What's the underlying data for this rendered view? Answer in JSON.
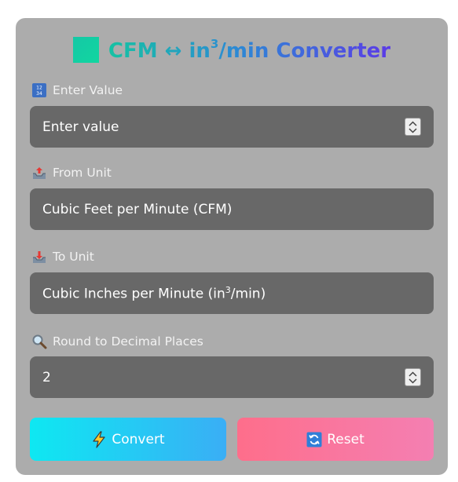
{
  "title": {
    "main": "CFM ↔ in",
    "sup": "3",
    "rest": "/min Converter"
  },
  "value_field": {
    "label": "Enter Value",
    "placeholder": "Enter value",
    "icon": "numbers-icon"
  },
  "from_field": {
    "label": "From Unit",
    "selected": "Cubic Feet per Minute (CFM)",
    "icon": "outbox-tray-icon"
  },
  "to_field": {
    "label": "To Unit",
    "selected_main": "Cubic Inches per Minute (in",
    "selected_sup": "3",
    "selected_rest": "/min)",
    "icon": "inbox-tray-icon"
  },
  "decimal_field": {
    "label": "Round to Decimal Places",
    "value": "2",
    "icon": "magnifier-icon"
  },
  "buttons": {
    "convert": "Convert",
    "reset": "Reset"
  },
  "colors": {
    "card_bg": "#acacac",
    "field_bg": "#686868",
    "convert_gradient": [
      "#0ee8f2",
      "#3aaef5"
    ],
    "reset_gradient": [
      "#fe6e8b",
      "#f47fb2"
    ]
  }
}
